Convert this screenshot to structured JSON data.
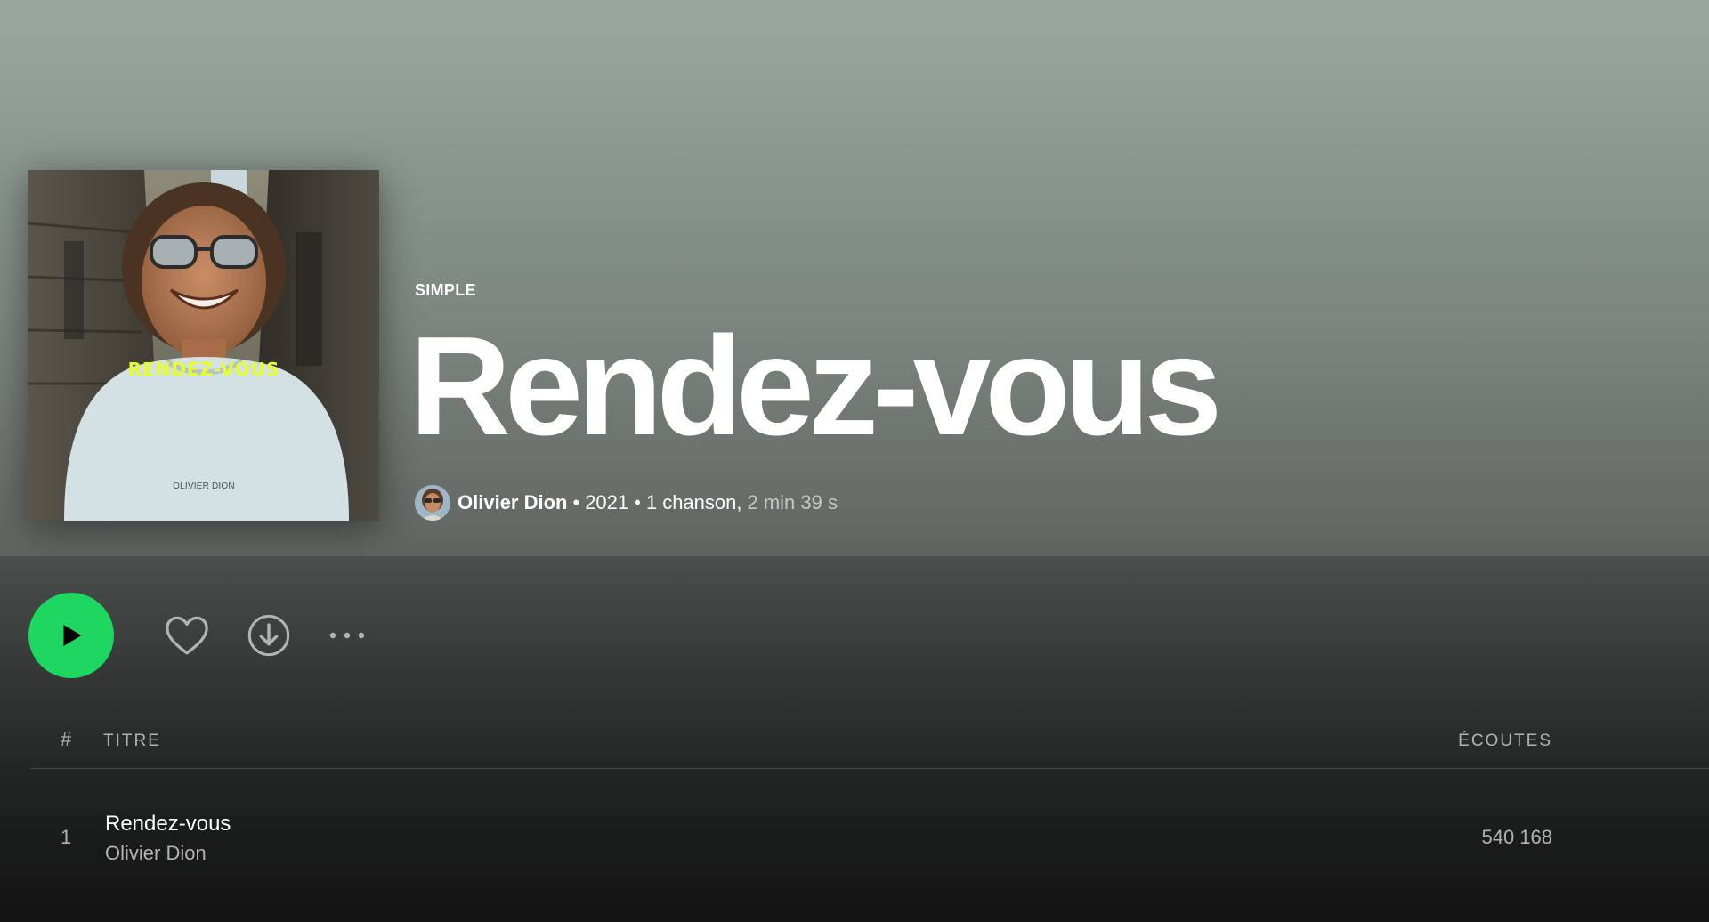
{
  "album": {
    "type_label": "SIMPLE",
    "title": "Rendez-vous",
    "cover_text": "RENDEZ-VOUS",
    "cover_artist_text": "OLIVIER DION",
    "artist": "Olivier Dion",
    "year": "2021",
    "track_count": "1 chanson,",
    "duration": "2 min 39 s",
    "separator": "•"
  },
  "actions": {
    "play_icon": "play-icon",
    "like_icon": "heart-icon",
    "download_icon": "download-icon",
    "more_icon": "more-horizontal-icon",
    "more_label": "..."
  },
  "tracklist": {
    "header_hash": "#",
    "header_title": "TITRE",
    "header_plays": "ÉCOUTES",
    "tracks": [
      {
        "number": "1",
        "title": "Rendez-vous",
        "artist": "Olivier Dion",
        "plays": "540 168"
      }
    ]
  },
  "colors": {
    "accent": "#1ed760",
    "cover_title": "#e6ff2b",
    "header_top": "#9aa79f",
    "background": "#121212"
  }
}
